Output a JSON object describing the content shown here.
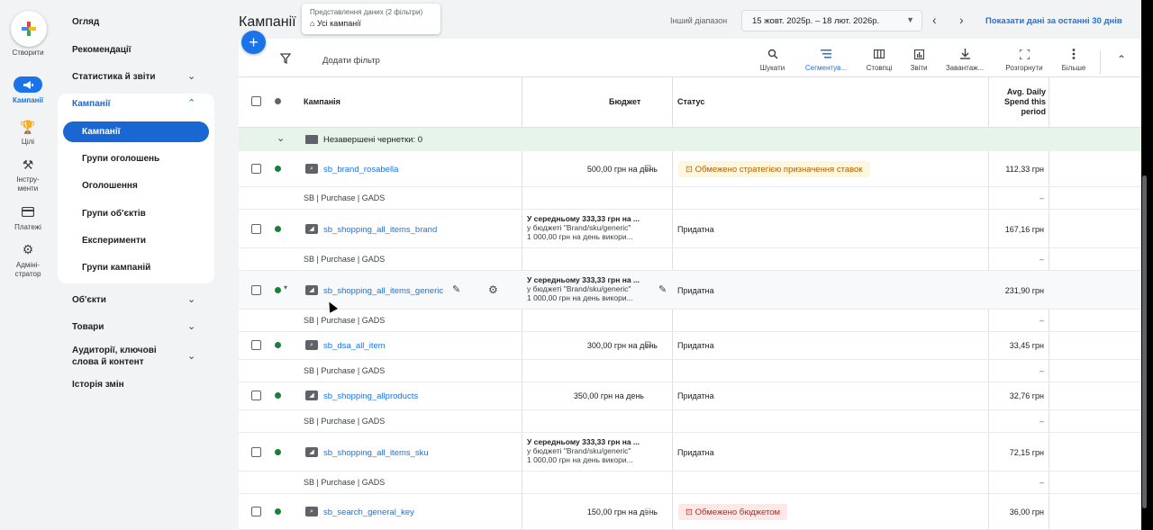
{
  "rail": {
    "create_label": "Створити",
    "items": [
      {
        "label": "Кампанії",
        "icon": "megaphone-icon",
        "active": true
      },
      {
        "label": "Цілі",
        "icon": "trophy-icon"
      },
      {
        "label": "Інстру-\nменти",
        "icon": "tools-icon"
      },
      {
        "label": "Платежі",
        "icon": "card-icon"
      },
      {
        "label": "Адміні-\nстратор",
        "icon": "gear-icon"
      }
    ]
  },
  "nav": {
    "overview": "Огляд",
    "recommendations": "Рекомендації",
    "stats": "Статистика й звіти",
    "campaigns": "Кампанії",
    "sub": [
      "Кампанії",
      "Групи оголошень",
      "Оголошення",
      "Групи об'єктів",
      "Експерименти",
      "Групи кампаній"
    ],
    "objects": "Об'єкти",
    "goods": "Товари",
    "audiences": "Аудиторії, ключові слова й контент",
    "history": "Історія змін"
  },
  "header": {
    "title": "Кампанії",
    "view_caption": "Представлення даних (2 фільтри)",
    "view_value": "Усі кампанії",
    "range_label": "Інший діапазон",
    "date_range": "15 жовт. 2025р. – 18 лют. 2026р.",
    "last30": "Показати дані за останні 30 днів"
  },
  "toolbar": {
    "add_filter": "Додати фільтр",
    "buttons": [
      {
        "label": "Шукати",
        "icon": "search-icon"
      },
      {
        "label": "Сегментув...",
        "icon": "segment-icon"
      },
      {
        "label": "Стовпці",
        "icon": "columns-icon"
      },
      {
        "label": "Звіти",
        "icon": "reports-icon"
      },
      {
        "label": "Завантаж...",
        "icon": "download-icon"
      },
      {
        "label": "Розгорнути",
        "icon": "expand-icon"
      },
      {
        "label": "Більше",
        "icon": "more-icon"
      }
    ]
  },
  "table": {
    "headers": {
      "campaign": "Кампанія",
      "budget": "Бюджет",
      "status": "Статус",
      "spend": "Avg. Daily Spend this period"
    },
    "drafts": "Незавершені чернетки: 0",
    "sub_label": "SB | Purchase | GADS",
    "dash": "–",
    "rows": [
      {
        "name": "sb_brand_rosabella",
        "budget": "500,00 грн на день",
        "status": "Обмежено стратегією призначення ставок",
        "spend": "112,33 грн"
      },
      {
        "name": "sb_shopping_all_items_brand",
        "budget1": "У середньому 333,33 грн на ...",
        "budget2": "у бюджеті \"Brand/sku/generic\"",
        "budget3": "1 000,00 грн на день викори...",
        "status": "Придатна",
        "spend": "167,16 грн"
      },
      {
        "name": "sb_shopping_all_items_generic",
        "budget1": "У середньому 333,33 грн на ...",
        "budget2": "у бюджеті \"Brand/sku/generic\"",
        "budget3": "1 000,00 грн на день викори...",
        "status": "Придатна",
        "spend": "231,90 грн"
      },
      {
        "name": "sb_dsa_all_item",
        "budget": "300,00 грн на день",
        "status": "Придатна",
        "spend": "33,45 грн"
      },
      {
        "name": "sb_shopping_allproducts",
        "budget": "350,00 грн на день",
        "status": "Придатна",
        "spend": "32,76 грн"
      },
      {
        "name": "sb_shopping_all_items_sku",
        "budget1": "У середньому 333,33 грн на ...",
        "budget2": "у бюджеті \"Brand/sku/generic\"",
        "budget3": "1 000,00 грн на день викори...",
        "status": "Придатна",
        "spend": "72,15 грн"
      },
      {
        "name": "sb_search_general_key",
        "budget": "150,00 грн на день",
        "status": "Обмежено бюджетом",
        "spend": "36,00 грн"
      }
    ]
  },
  "colors": {
    "accent": "#1a73e8",
    "enabled": "#188038",
    "draft_bg": "#e6f4ea"
  }
}
